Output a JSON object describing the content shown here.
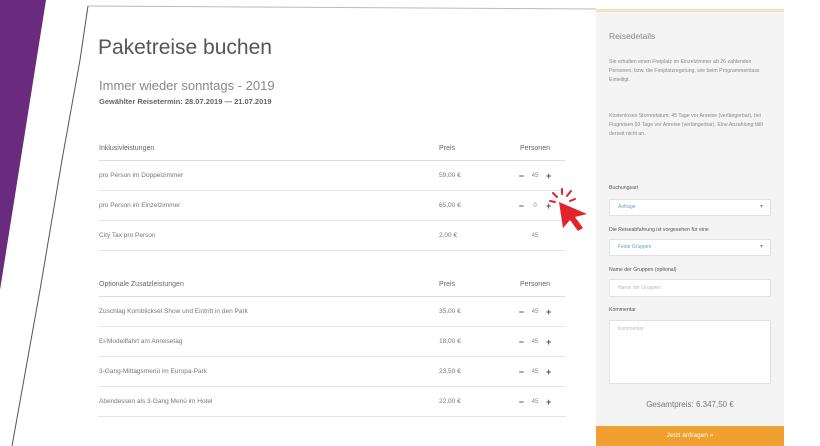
{
  "colors": {
    "accent_purple": "#6a2a7e",
    "cta_orange": "#f0a030",
    "cursor_red": "#e2232c",
    "link_blue": "#6a9fc8"
  },
  "booking": {
    "title": "Paketreise buchen",
    "subtitle": "Immer wieder sonntags - 2019",
    "dates": "Gewählter Reisetermin: 28.07.2019 — 21.07.2019"
  },
  "inclusive": {
    "headers": {
      "name": "Inklusivleistungen",
      "price": "Preis",
      "persons": "Personen"
    },
    "rows": [
      {
        "name": "pro Person im Doppelzimmer",
        "price": "59,00 €",
        "qty": "45",
        "stepper": true
      },
      {
        "name": "pro Person im Einzelzimmer",
        "price": "65,00 €",
        "qty": "0",
        "stepper": true
      },
      {
        "name": "City Tax pro Person",
        "price": "2,00 €",
        "qty": "45",
        "stepper": false
      }
    ]
  },
  "optional": {
    "headers": {
      "name": "Optionale Zusatzleistungen",
      "price": "Preis",
      "persons": "Personen"
    },
    "rows": [
      {
        "name": "Zuschlag Kornblicksel Show und Eintritt in den Park",
        "price": "35,00 €",
        "qty": "45"
      },
      {
        "name": "Ei-Modellfahrt am Anreisetag",
        "price": "18,00 €",
        "qty": "45"
      },
      {
        "name": "3-Gang-Mittagsmenü im Europa-Park",
        "price": "23,50 €",
        "qty": "45"
      },
      {
        "name": "Abendessen als 3-Gang Menü im Hotel",
        "price": "22,00 €",
        "qty": "45"
      }
    ]
  },
  "sidebar": {
    "title": "Reisedetails",
    "para1": "Sie erhalten einen Freiplatz im Einzelzimmer ab 26 zahlenden Personen, bzw. die Freiplatzregelung, wie beim Programmeinlass Einteiligt.",
    "para2": "Kostenloses Stornodatum: 45 Tage vor Anreise (verlängerbar), bei Flugreisen 93 Tage vor Anreise (verlängerbar). Eine Anzahlung fällt derzeit nicht an.",
    "booking_type_label": "Buchungsart",
    "booking_type_value": "Anfrage",
    "group_label": "Die Reiseabfahrung ist vorgesehen für eine",
    "group_value": "Feste Gruppen",
    "group_name_label": "Name der Gruppen (optional)",
    "group_name_placeholder": "Name der Gruppen",
    "comment_label": "Kommentar",
    "comment_placeholder": "Kommentar",
    "total": "Gesamtpreis: 6.347,50 €",
    "cta": "Jetzt anfragen"
  }
}
